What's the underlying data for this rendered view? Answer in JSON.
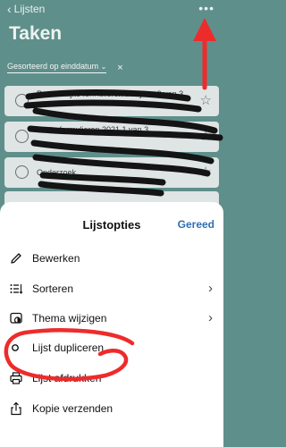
{
  "nav": {
    "back_label": "Lijsten",
    "more_label": "•••"
  },
  "page": {
    "title": "Taken"
  },
  "sort": {
    "label": "Gesorteerd op einddatum",
    "chevron": "⌄",
    "clear": "×"
  },
  "tasks": [
    {
      "text": "Persoonlijke formulieren bekijken 0 van 3"
    },
    {
      "text": "Acute formulieren 2021 1 van 3"
    },
    {
      "text": "Onderzoek"
    }
  ],
  "sheet": {
    "title": "Lijstopties",
    "done_label": "Gereed",
    "items": [
      {
        "label": "Bewerken",
        "icon": "pencil-icon",
        "has_arrow": false
      },
      {
        "label": "Sorteren",
        "icon": "sort-icon",
        "has_arrow": true
      },
      {
        "label": "Thema wijzigen",
        "icon": "theme-icon",
        "has_arrow": true
      },
      {
        "label": "Lijst dupliceren",
        "icon": "duplicate-icon",
        "has_arrow": false
      },
      {
        "label": "Lijst afdrukken",
        "icon": "printer-icon",
        "has_arrow": false
      },
      {
        "label": "Kopie verzenden",
        "icon": "share-icon",
        "has_arrow": false
      }
    ],
    "arrow_glyph": "›"
  },
  "colors": {
    "background": "#5f8f8b",
    "accent": "#2f6fb3",
    "annotation": "#ee2b2b"
  }
}
